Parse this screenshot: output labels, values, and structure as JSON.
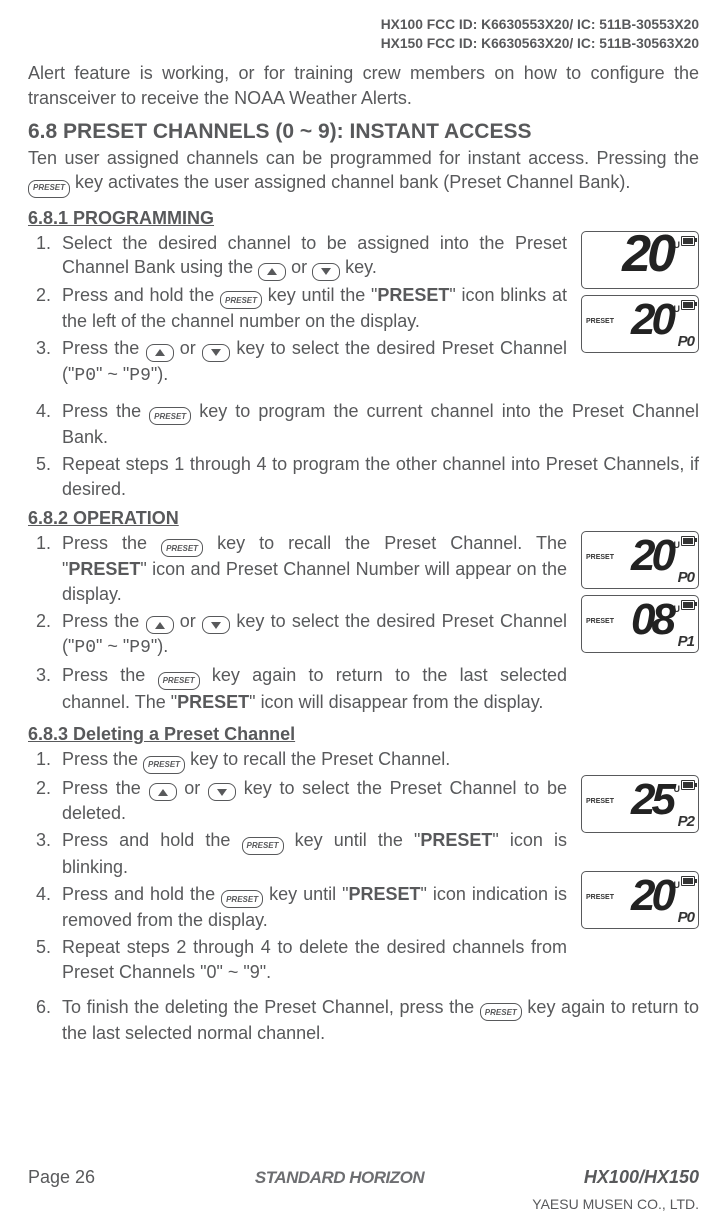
{
  "header": {
    "line1": "HX100 FCC ID: K6630553X20/ IC: 511B-30553X20",
    "line2": "HX150 FCC ID: K6630563X20/ IC: 511B-30563X20"
  },
  "intro": "Alert feature is working, or for training crew members on how to configure the transceiver to receive the NOAA Weather Alerts.",
  "section68": {
    "title": "6.8 PRESET CHANNELS (0 ~ 9): INSTANT ACCESS",
    "desc_a": "Ten user assigned channels can be programmed for instant access. Pressing the ",
    "desc_b": " key activates the user assigned channel bank (Preset Channel Bank)."
  },
  "icons": {
    "preset_label": "PRESET"
  },
  "s681": {
    "title": "6.8.1 PROGRAMMING",
    "li1_a": "Select the desired channel to be assigned into the Pre­set Channel Bank using the ",
    "li1_b": " or ",
    "li1_c": " key.",
    "li2_a": "Press and hold the ",
    "li2_b": " key until the \"",
    "li2_preset": "PRESET",
    "li2_c": "\" icon blinks at the left of the channel number on the display.",
    "li3_a": "Press the ",
    "li3_b": " or ",
    "li3_c": " key to select the desired Preset Channel (\"",
    "li3_p0": "P0",
    "li3_d": "\" ~ \"",
    "li3_p9": "P9",
    "li3_e": "\").",
    "li4_a": "Press the ",
    "li4_b": " key to program the current channel into the Preset Chan­nel Bank.",
    "li5": "Repeat steps 1 through 4 to program the other channel into Preset Chan­nels, if desired.",
    "lcd1_big": "20",
    "lcd2_big": "20",
    "lcd2_p": "P0"
  },
  "s682": {
    "title": "6.8.2 OPERATION",
    "li1_a": "Press the ",
    "li1_b": " key to recall the Preset Channel. The \"",
    "li1_preset": "PRESET",
    "li1_c": "\" icon and Preset Channel Number will ap­pear on the display.",
    "li2_a": "Press the ",
    "li2_b": " or ",
    "li2_c": " key to select the desired Preset Channel (\"",
    "li2_p0": "P0",
    "li2_d": "\" ~ \"",
    "li2_p9": "P9",
    "li2_e": "\").",
    "li3_a": "Press the ",
    "li3_b": " key again to return to the last selected channel. The \"",
    "li3_preset": "PRESET",
    "li3_c": "\" icon will disappear from the display.",
    "lcd1_big": "20",
    "lcd1_p": "P0",
    "lcd2_big": "08",
    "lcd2_p": "P1"
  },
  "s683": {
    "title": "6.8.3 Deleting a Preset Channel",
    "li1_a": "Press the ",
    "li1_b": " key to recall the Preset Channel.",
    "li2_a": "Press the ",
    "li2_b": " or ",
    "li2_c": " key to select the Preset Channel to be deleted.",
    "li3_a": "Press and hold the ",
    "li3_b": " key until the \"",
    "li3_preset": "PRESET",
    "li3_c": "\" icon is blinking.",
    "li4_a": "Press and hold the ",
    "li4_b": " key until \"",
    "li4_preset": "PRESET",
    "li4_c": "\" icon indi­cation is removed from the display.",
    "li5": "Repeat steps 2 through 4 to delete the desired chan­nels from Preset Channels \"0\" ~ \"9\".",
    "li6_a": "To finish the deleting the Preset Channel, press the ",
    "li6_b": " key again to re­turn to the last selected normal channel.",
    "lcd1_big": "25",
    "lcd1_p": "P2",
    "lcd2_big": "20",
    "lcd2_p": "P0"
  },
  "footer": {
    "page": "Page 26",
    "brand": "STANDARD HORIZON",
    "model": "HX100/HX150",
    "company": "YAESU MUSEN CO., LTD."
  }
}
